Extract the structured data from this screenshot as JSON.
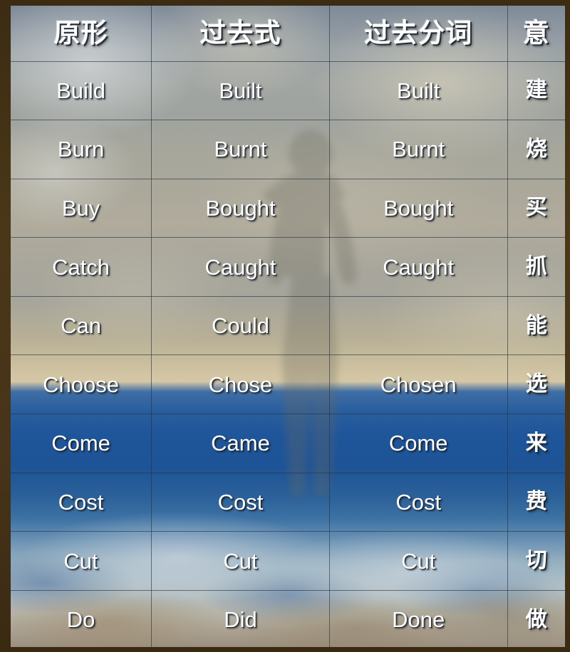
{
  "table": {
    "headers": [
      {
        "label": "原形",
        "key": "base"
      },
      {
        "label": "过去式",
        "key": "past"
      },
      {
        "label": "过去分词",
        "key": "participle"
      },
      {
        "label": "意",
        "key": "meaning"
      }
    ],
    "rows": [
      {
        "base": "Build",
        "past": "Built",
        "participle": "Built",
        "meaning": "建"
      },
      {
        "base": "Burn",
        "past": "Burnt",
        "participle": "Burnt",
        "meaning": "烧"
      },
      {
        "base": "Buy",
        "past": "Bought",
        "participle": "Bought",
        "meaning": "买"
      },
      {
        "base": "Catch",
        "past": "Caught",
        "participle": "Caught",
        "meaning": "抓"
      },
      {
        "base": "Can",
        "past": "Could",
        "participle": "",
        "meaning": "能"
      },
      {
        "base": "Choose",
        "past": "Chose",
        "participle": "Chosen",
        "meaning": "选"
      },
      {
        "base": "Come",
        "past": "Came",
        "participle": "Come",
        "meaning": "来"
      },
      {
        "base": "Cost",
        "past": "Cost",
        "participle": "Cost",
        "meaning": "费"
      },
      {
        "base": "Cut",
        "past": "Cut",
        "participle": "Cut",
        "meaning": "切"
      },
      {
        "base": "Do",
        "past": "Did",
        "participle": "Done",
        "meaning": "做"
      }
    ]
  },
  "style": {
    "text_color": "#ffffff",
    "grid_line_color": "#283040",
    "frame_color": "#46341a",
    "ocean_color": "#1f559a",
    "sand_color": "#d6c8a6",
    "sky_color": "#7e8b97"
  },
  "background": {
    "description": "beach-photo-backdrop",
    "silhouette_name": "figure-silhouette"
  }
}
